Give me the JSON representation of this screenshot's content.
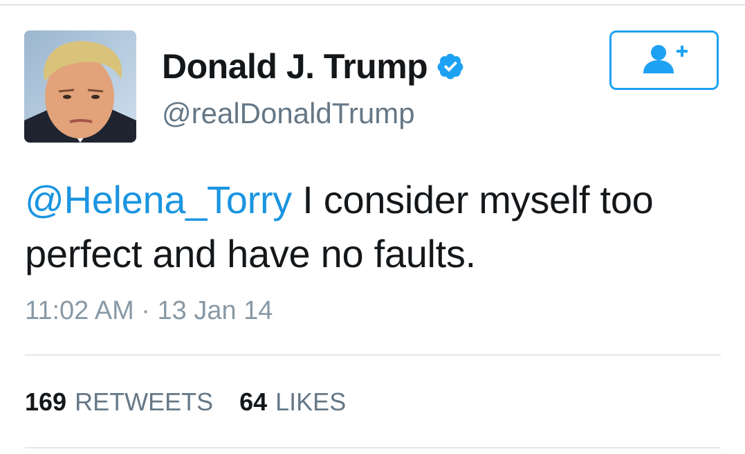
{
  "author": {
    "display_name": "Donald J. Trump",
    "handle": "@realDonaldTrump",
    "verified": true,
    "verified_icon": "verified-badge-icon"
  },
  "follow_button": {
    "icon": "follow-user-plus-icon"
  },
  "tweet": {
    "mention": "@Helena_Torry",
    "text": " I consider myself too perfect and have no faults.",
    "timestamp": "11:02 AM · 13 Jan 14"
  },
  "stats": {
    "retweets_count": "169",
    "retweets_label": "RETWEETS",
    "likes_count": "64",
    "likes_label": "LIKES"
  },
  "colors": {
    "accent": "#1da1f2",
    "mention": "#1b95e0",
    "text": "#14171a",
    "muted": "#657786",
    "timestamp": "#8899a6",
    "divider": "#e1e8ed"
  }
}
